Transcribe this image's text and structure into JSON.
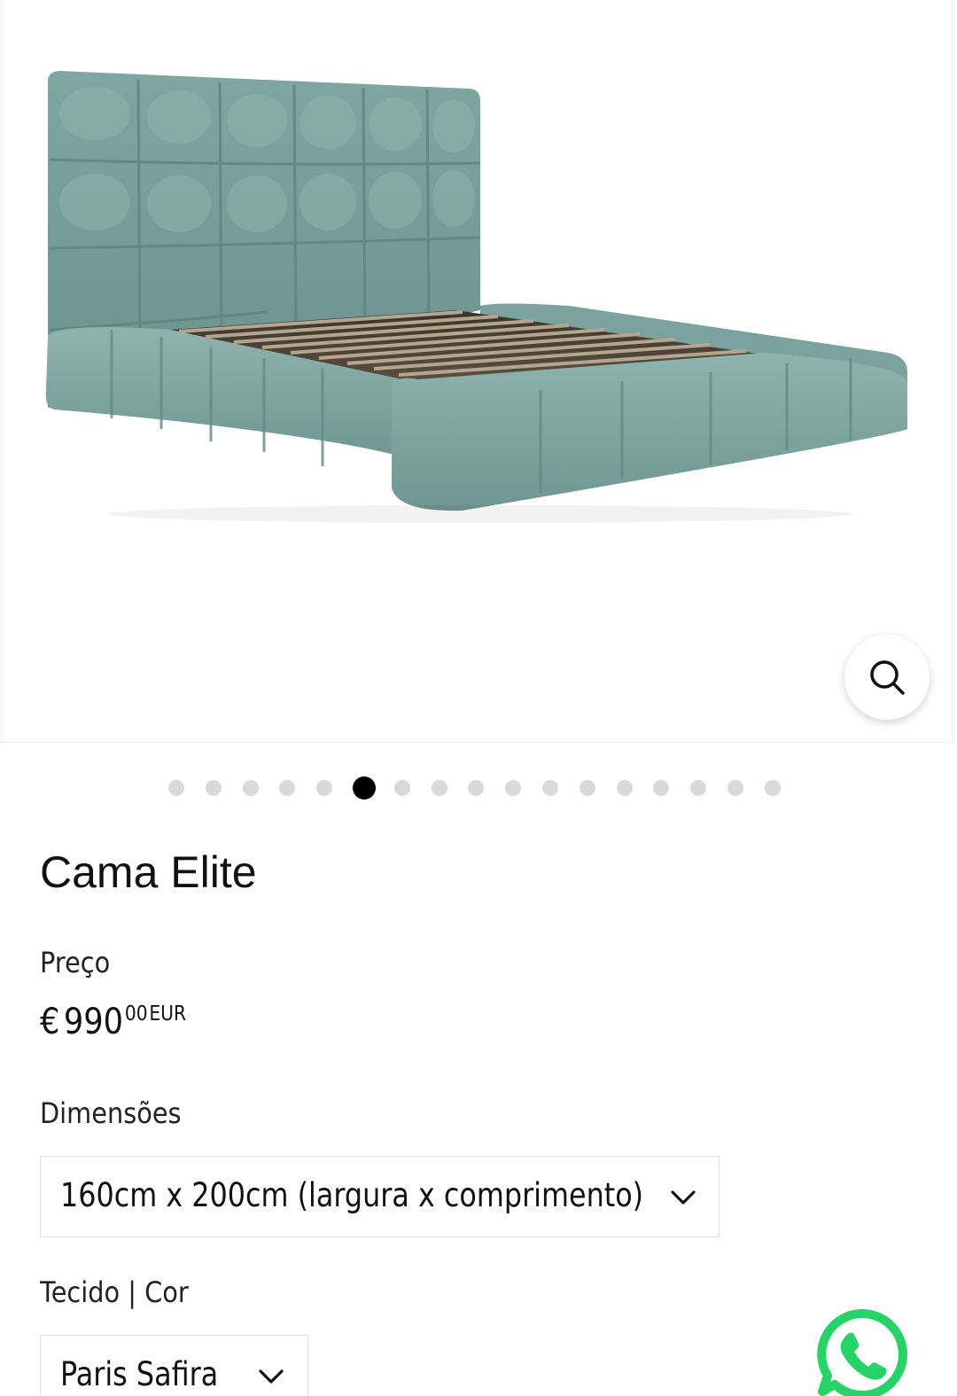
{
  "product": {
    "title": "Cama Elite",
    "image_alt": "teal tufted upholstered bed",
    "carousel": {
      "total": 17,
      "active_index": 5
    }
  },
  "price": {
    "label": "Preço",
    "currency_symbol": "€",
    "amount": "990",
    "cents": "00",
    "currency_code": "EUR"
  },
  "options": {
    "dimensions": {
      "label": "Dimensões",
      "selected": "160cm x 200cm (largura x comprimento)"
    },
    "fabric": {
      "label": "Tecido | Cor",
      "selected": "Paris Safira"
    }
  },
  "colors": {
    "bed_fabric": "#7fa6a2",
    "whatsapp": "#25d366",
    "dot_active": "#000000",
    "dot_inactive": "#d9d9d9"
  },
  "icons": {
    "zoom": "search-icon",
    "select": "chevron-down-icon",
    "chat": "whatsapp-icon"
  }
}
